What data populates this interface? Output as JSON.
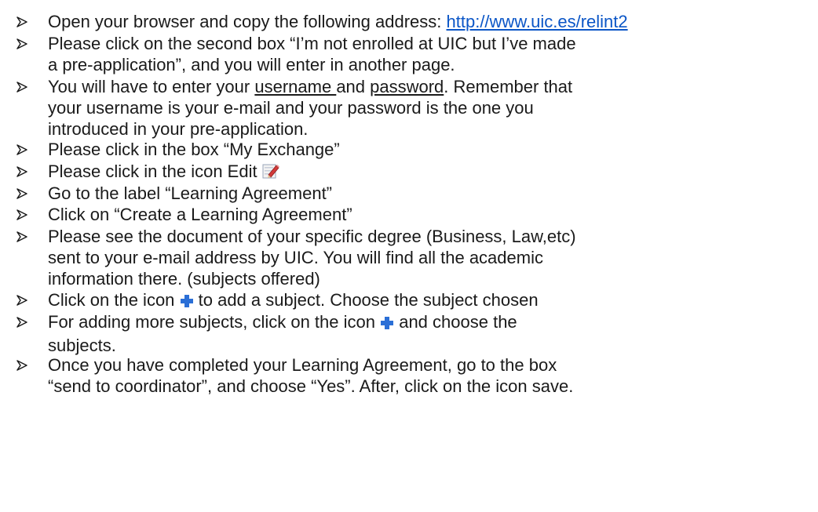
{
  "instructions": [
    {
      "lines": [
        {
          "text_before": "Open your browser and copy the following address: ",
          "link": "http://www.uic.es/relint2"
        }
      ]
    },
    {
      "lines": [
        "Please click on the second box “I’m not enrolled at UIC but I’ve made",
        "a pre-application”, and you will enter in another page."
      ]
    },
    {
      "lines": [
        {
          "part1": "You will have to enter your ",
          "username": "username ",
          "part2": "and ",
          "password": "password",
          "part3": ". Remember that"
        },
        "your username is your e-mail and your password is the one you",
        "introduced in your pre-application."
      ]
    },
    {
      "lines": [
        "Please click in the box “My Exchange”"
      ]
    },
    {
      "lines": [
        {
          "text": "Please click in the icon Edit",
          "icon": "edit-icon"
        }
      ]
    },
    {
      "lines": [
        "Go to the label “Learning Agreement”"
      ]
    },
    {
      "lines": [
        "Click on “Create a Learning Agreement”"
      ]
    },
    {
      "lines": [
        "Please see the document of your specific degree (Business, Law,etc)",
        "sent to your e-mail address by UIC. You will find all the academic",
        "information there. (subjects offered)"
      ]
    },
    {
      "lines": [
        {
          "before": "Click on the icon ",
          "icon": "add-plus-icon",
          "after": " to add a subject. Choose the subject chosen"
        }
      ]
    },
    {
      "lines": [
        {
          "before": "For adding more subjects, click on the icon ",
          "icon": "add-plus-icon",
          "after": " and choose the"
        },
        "subjects."
      ]
    },
    {
      "lines": [
        "Once you have completed your Learning Agreement, go to the box",
        "“send to coordinator”, and choose “Yes”. After, click on the icon save."
      ]
    }
  ],
  "colors": {
    "text": "#1a1a1a",
    "link": "#0b56c7",
    "plus_icon": "#2b6fd6"
  }
}
